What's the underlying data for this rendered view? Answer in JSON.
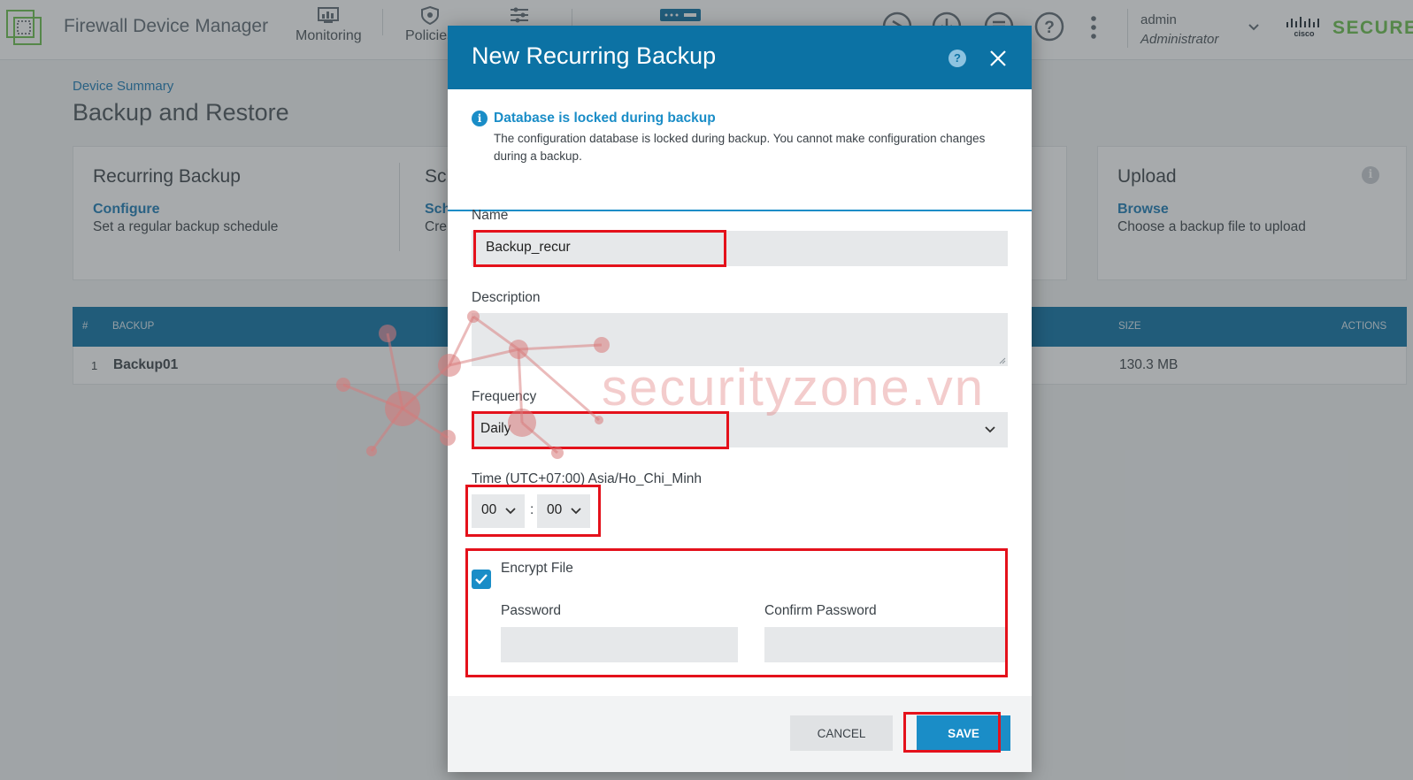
{
  "header": {
    "app_title": "Firewall Device Manager",
    "nav": [
      {
        "label": "Monitoring",
        "icon": "monitoring-icon"
      },
      {
        "label": "Policies",
        "icon": "policies-icon"
      },
      {
        "label": "",
        "icon": "objects-icon"
      },
      {
        "label": "",
        "icon": "device-icon"
      }
    ],
    "user": {
      "name": "admin",
      "role": "Administrator"
    },
    "brand": "SECURE",
    "brand_logo_text": "cisco"
  },
  "page": {
    "breadcrumb": "Device Summary",
    "title": "Backup and Restore"
  },
  "cards": [
    {
      "title": "Recurring Backup",
      "link": "Configure",
      "desc": "Set a regular backup schedule"
    },
    {
      "title": "Sch",
      "link": "Sch",
      "desc": "Cre"
    },
    {
      "title": "Upload",
      "link": "Browse",
      "desc": "Choose a backup file to upload"
    }
  ],
  "table": {
    "columns": {
      "index": "#",
      "backup": "BACKUP",
      "size": "SIZE",
      "actions": "ACTIONS"
    },
    "rows": [
      {
        "index": "1",
        "backup": "Backup01",
        "size": "130.3 MB"
      }
    ]
  },
  "watermark": "securityzone.vn",
  "modal": {
    "title": "New Recurring Backup",
    "alert_title": "Database is locked during backup",
    "alert_text": "The configuration database is locked during backup. You cannot make configuration changes during a backup.",
    "name_label": "Name",
    "name_value": "Backup_recur",
    "description_label": "Description",
    "description_value": "",
    "frequency_label": "Frequency",
    "frequency_value": "Daily",
    "time_label": "Time (UTC+07:00) Asia/Ho_Chi_Minh",
    "hour_value": "00",
    "time_sep": ":",
    "minute_value": "00",
    "encrypt_label": "Encrypt File",
    "encrypt_checked": true,
    "password_label": "Password",
    "confirm_password_label": "Confirm Password",
    "cancel_label": "CANCEL",
    "save_label": "SAVE"
  },
  "colors": {
    "primary": "#0c72a4",
    "accent": "#1a8dc7",
    "highlight": "#e4111b",
    "secure_green": "#6abf4b"
  }
}
